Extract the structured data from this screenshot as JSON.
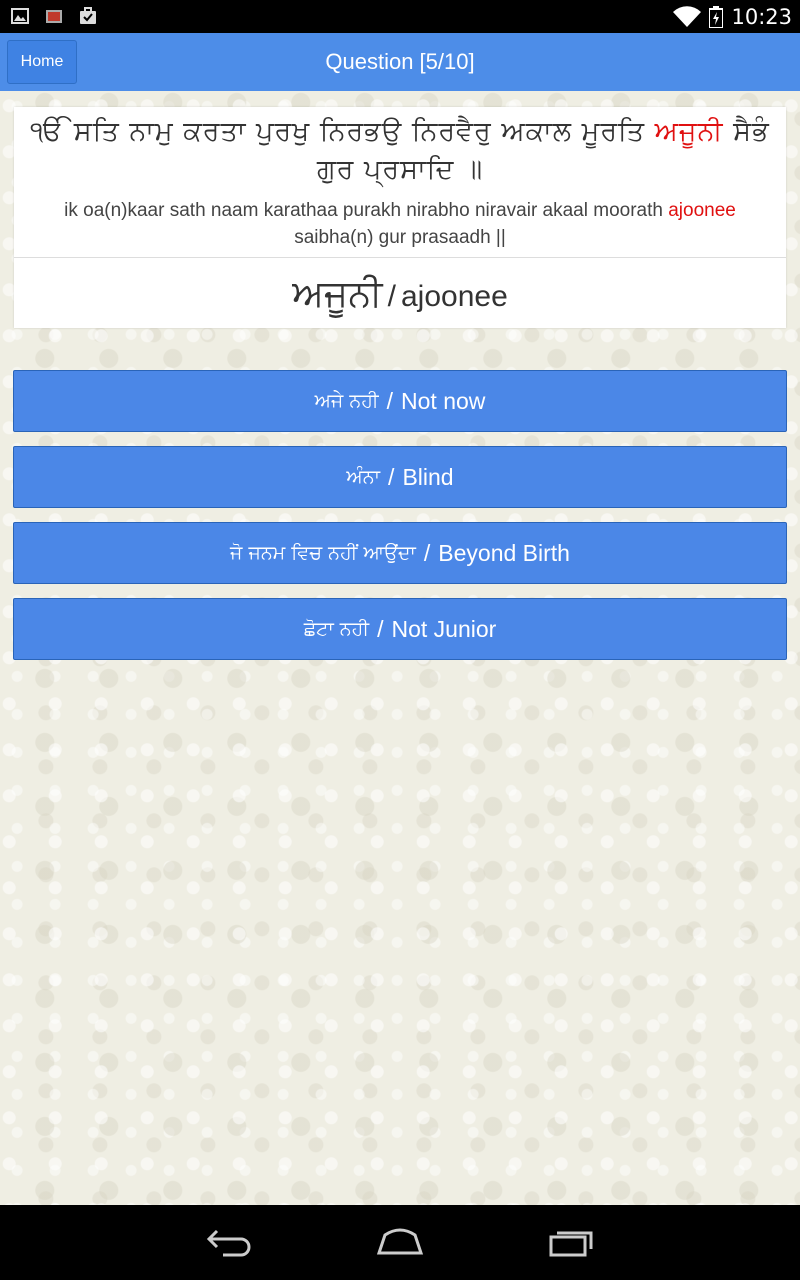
{
  "status_bar": {
    "time": "10:23",
    "left_icons": [
      "image-icon",
      "media-icon",
      "briefcase-check-icon"
    ],
    "right_icons": [
      "wifi-icon",
      "battery-icon"
    ]
  },
  "action_bar": {
    "home_label": "Home",
    "title": "Question [5/10]"
  },
  "question": {
    "gurmukhi_before": "ੴ ਸਤਿ ਨਾਮੁ ਕਰਤਾ ਪੁਰਖੁ ਨਿਰਭਉ ਨਿਰਵੈਰੁ ਅਕਾਲ ਮੂਰਤਿ ",
    "gurmukhi_highlight": "ਅਜੂਨੀ",
    "gurmukhi_after": " ਸੈਭੰ ਗੁਰ ਪ੍ਰਸਾਦਿ ॥",
    "translit_before": "ik oa(n)kaar sath naam karathaa purakh nirabho niravair akaal moorath ",
    "translit_highlight": "ajoonee",
    "translit_after": " saibha(n) gur prasaadh ||",
    "word_gurmukhi": "ਅਜੂਨੀ",
    "word_separator": "/",
    "word_translit": "ajoonee",
    "highlight_color": "#e01010"
  },
  "options": [
    {
      "gurmukhi": "ਅਜੇ ਨਹੀ",
      "english": "Not now"
    },
    {
      "gurmukhi": "ਅੰਨਾ",
      "english": "Blind"
    },
    {
      "gurmukhi": "ਜੋ ਜਨਮ ਵਿਚ ਨਹੀਂ ਆਉਂਦਾ",
      "english": "Beyond Birth"
    },
    {
      "gurmukhi": "ਛੋਟਾ ਨਹੀ",
      "english": "Not Junior"
    }
  ],
  "option_separator": "/",
  "colors": {
    "accent": "#4d8de8",
    "button": "#4b87e7",
    "background": "#efeee3"
  },
  "nav_bar": [
    "back-icon",
    "home-icon",
    "recent-apps-icon"
  ]
}
